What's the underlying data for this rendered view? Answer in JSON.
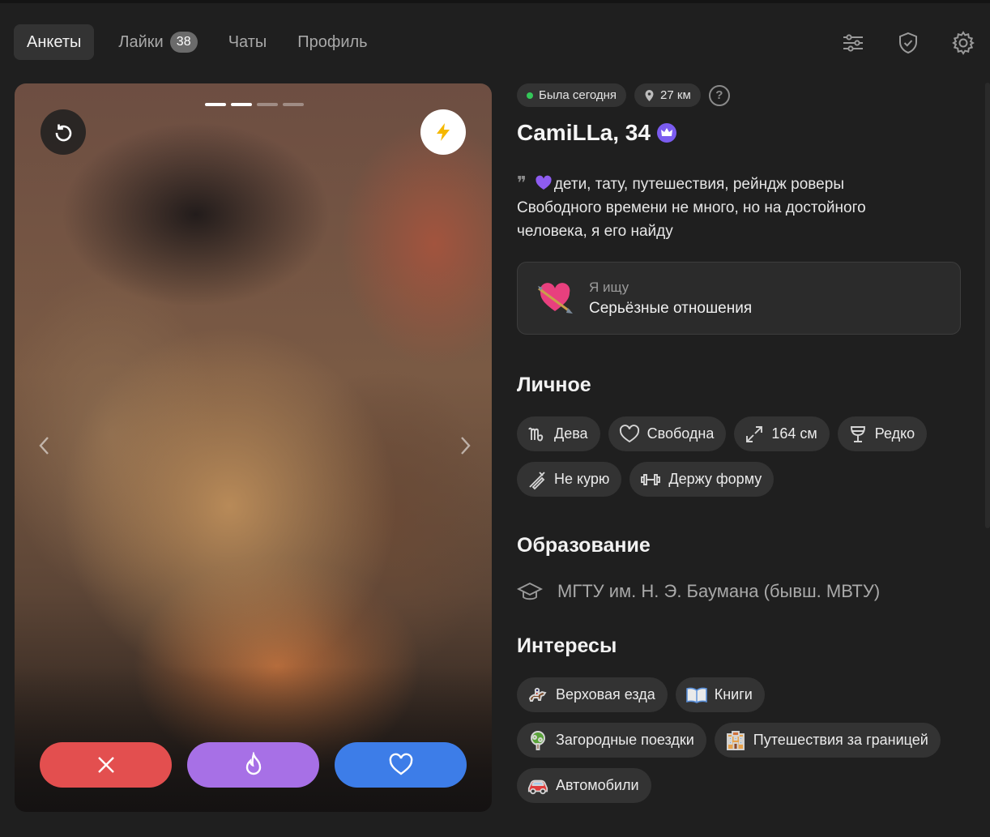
{
  "nav": {
    "tabs": [
      {
        "label": "Анкеты",
        "active": true
      },
      {
        "label": "Лайки",
        "badge": "38"
      },
      {
        "label": "Чаты"
      },
      {
        "label": "Профиль"
      }
    ],
    "icons": [
      "filters-icon",
      "shield-check-icon",
      "gear-icon"
    ]
  },
  "photo": {
    "pages_total": 4,
    "pages_seen": 2,
    "buttons": [
      "undo-icon",
      "lightning-icon",
      "close-icon",
      "fire-icon",
      "heart-icon"
    ]
  },
  "profile": {
    "status": "Была сегодня",
    "distance": "27 км",
    "name": "CamiLLa, 34",
    "bio": "дети, тату, путешествия, рейндж роверы Свободного времени не много, но на достойного человека, я его найду",
    "seeking_label": "Я ищу",
    "seeking_value": "Серьёзные отношения"
  },
  "personal": {
    "title": "Личное",
    "tags": [
      {
        "icon": "virgo-icon",
        "label": "Дева"
      },
      {
        "icon": "heart-outline-icon",
        "label": "Свободна"
      },
      {
        "icon": "expand-icon",
        "label": "164 см"
      },
      {
        "icon": "glass-icon",
        "label": "Редко"
      },
      {
        "icon": "no-smoking-icon",
        "label": "Не курю"
      },
      {
        "icon": "dumbbell-icon",
        "label": "Держу форму"
      }
    ]
  },
  "education": {
    "title": "Образование",
    "value": "МГТУ им. Н. Э. Баумана (бывш. МВТУ)"
  },
  "interests": {
    "title": "Интересы",
    "tags": [
      {
        "icon": "horse-riding-icon",
        "label": "Верховая езда"
      },
      {
        "icon": "book-icon",
        "label": "Книги"
      },
      {
        "icon": "tree-icon",
        "label": "Загородные поездки"
      },
      {
        "icon": "hotel-icon",
        "label": "Путешествия за границей"
      },
      {
        "icon": "car-icon",
        "label": "Автомобили"
      }
    ]
  },
  "colors": {
    "accent_dislike": "#e34f4f",
    "accent_super": "#a770e6",
    "accent_like": "#3d7de8",
    "online": "#34c759"
  }
}
